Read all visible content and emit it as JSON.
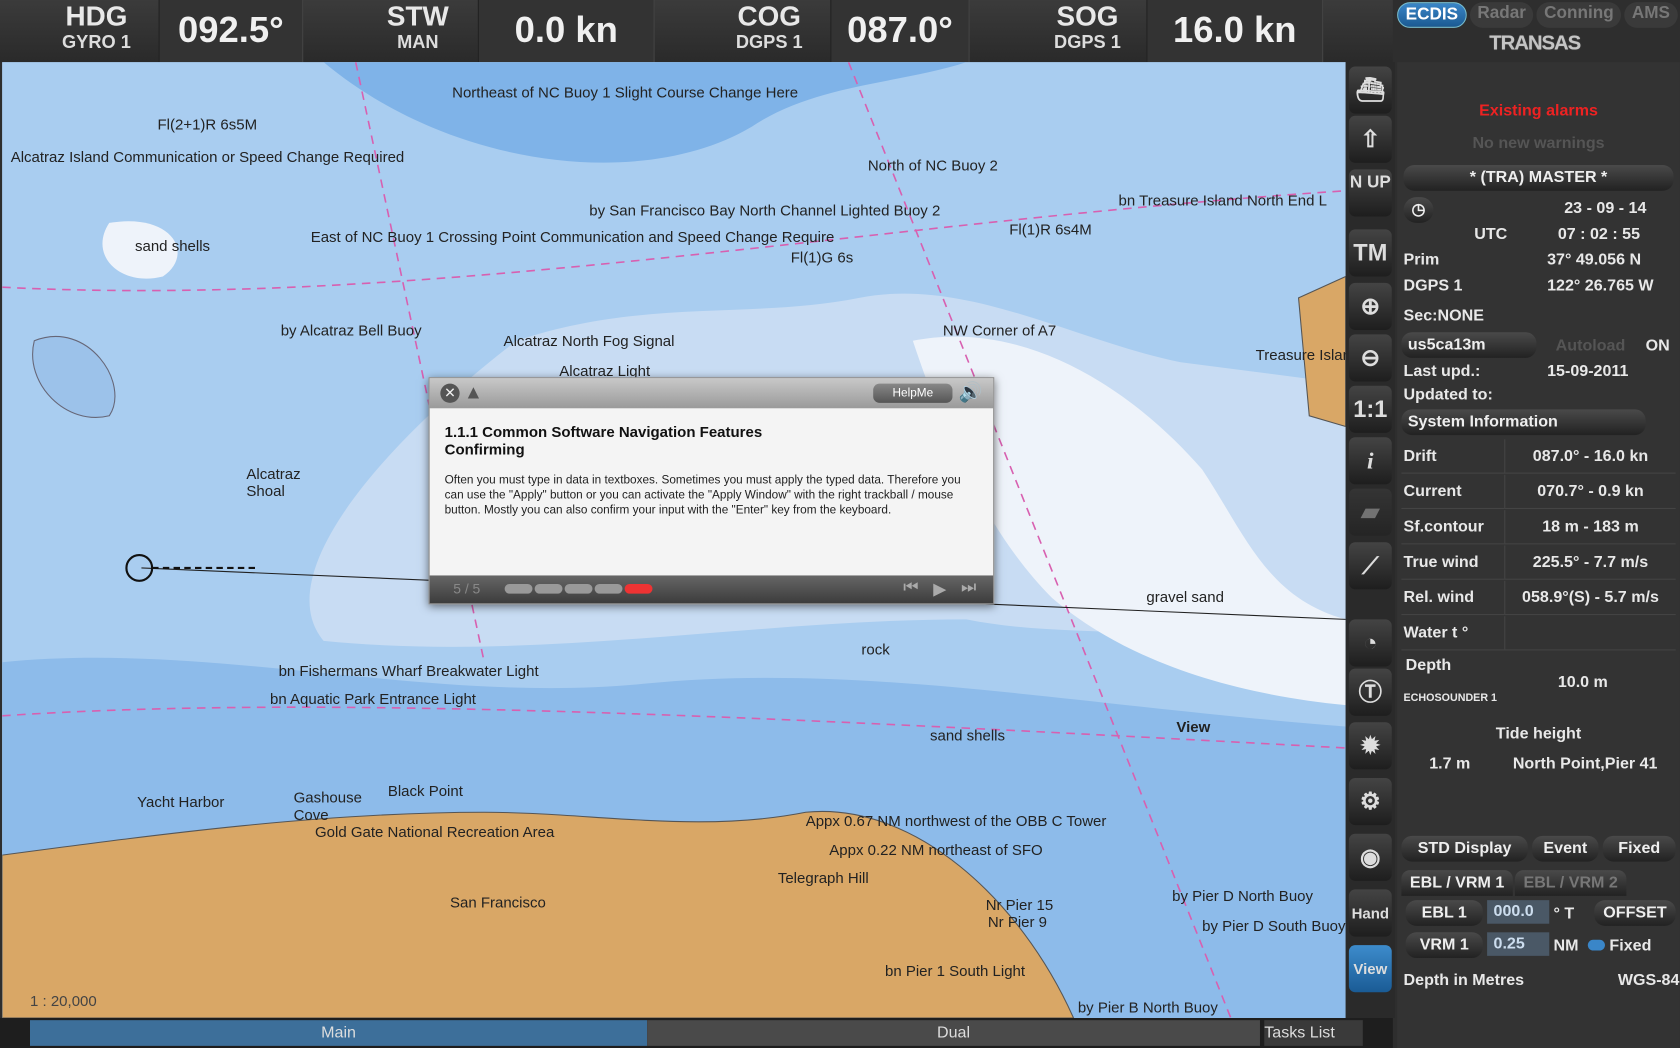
{
  "header": {
    "hdg": {
      "label": "HDG",
      "source": "GYRO 1",
      "value": "092.5°"
    },
    "stw": {
      "label": "STW",
      "source": "MAN",
      "value": "0.0 kn"
    },
    "cog": {
      "label": "COG",
      "source": "DGPS 1",
      "value": "087.0°"
    },
    "sog": {
      "label": "SOG",
      "source": "DGPS 1",
      "value": "16.0 kn"
    }
  },
  "modes": [
    "ECDIS",
    "Radar",
    "Conning",
    "AMS"
  ],
  "brand": "TRANSAS",
  "map": {
    "scale": "1 : 20,000",
    "labels": [
      "Northeast of NC Buoy 1 Slight Course Change Here",
      "Alcatraz Island Communication or Speed Change Required",
      "Fl(2+1)R 6s5M",
      "North of NC Buoy 2",
      "bn Treasure Island North End L",
      "by San Francisco Bay North Channel Lighted Buoy 2",
      "East of NC Buoy 1 Crossing Point Communication and Speed Change Require",
      "Fl(1)G 6s",
      "Fl(1)R 6s4M",
      "sand shells",
      "by Alcatraz Bell Buoy",
      "Alcatraz North Fog Signal",
      "Alcatraz Light",
      "NW Corner of A7",
      "Treasure Island",
      "Alcatraz Shoal",
      "gravel sand",
      "rock",
      "View",
      "bn Fishermans Wharf Breakwater Light",
      "bn Aquatic Park Entrance Light",
      "Yacht Harbor",
      "Black Point",
      "Gashouse Cove",
      "Gold Gate National Recreation Area",
      "Appx 0.67 NM northwest of the OBB C Tower",
      "Appx 0.22 NM northeast of SFO",
      "Telegraph Hill",
      "San Francisco",
      "by Pier D North Buoy",
      "by Pier D South Buoy",
      "bn Pier 1 South Light",
      "by Pier B North Buoy",
      "sand shells",
      "Nr Pier 15",
      "Nr Pier 9"
    ]
  },
  "tools": {
    "nup": "N UP",
    "tm": "TM",
    "one": "1:1",
    "info": "i",
    "hand": "Hand",
    "view": "View"
  },
  "panel": {
    "alarms": "Existing alarms",
    "warnings": "No new warnings",
    "user": "* (TRA) MASTER *",
    "date": "23 - 09 - 14",
    "utc_label": "UTC",
    "time": "07 : 02 : 55",
    "prim_label": "Prim",
    "lat": "37° 49.056 N",
    "dgps_label": "DGPS 1",
    "lon": "122° 26.765 W",
    "sec": "Sec:NONE",
    "chart": "us5ca13m",
    "autoload": "Autoload",
    "autoload_state": "ON",
    "last_upd_label": "Last upd.:",
    "last_upd": "15-09-2011",
    "updated_to_label": "Updated to:",
    "sysinfo": "System Information",
    "rows": [
      {
        "k": "Drift",
        "v": "087.0° - 16.0 kn"
      },
      {
        "k": "Current",
        "v": "070.7° - 0.9 kn"
      },
      {
        "k": "Sf.contour",
        "v": "18 m - 183 m"
      },
      {
        "k": "True wind",
        "v": "225.5° - 7.7 m/s"
      },
      {
        "k": "Rel. wind",
        "v": "058.9°(S) - 5.7 m/s"
      },
      {
        "k": "Water t °",
        "v": ""
      }
    ],
    "depth_label": "Depth",
    "depth_src": "ECHOSOUNDER 1",
    "depth": "10.0 m",
    "tide_label": "Tide height",
    "tide": "1.7 m",
    "tide_loc": "North Point,Pier 41",
    "std": "STD Display",
    "event": "Event",
    "fixed": "Fixed",
    "ebl_tab1": "EBL / VRM 1",
    "ebl_tab2": "EBL / VRM 2",
    "ebl": "EBL 1",
    "ebl_val": "000.0",
    "ebl_unit": "° T",
    "offset": "OFFSET",
    "vrm": "VRM 1",
    "vrm_val": "0.25",
    "vrm_unit": "NM",
    "vrm_fixed": "Fixed",
    "depth_units": "Depth in Metres",
    "datum": "WGS-84"
  },
  "dialog": {
    "helpme": "HelpMe",
    "title1": "1.1.1 Common Software Navigation Features",
    "title2": "Confirming",
    "body": "Often you must type in data in textboxes. Sometimes you must apply the typed data. Therefore you can use the \"Apply\" button or you can activate the \"Apply  Window\" with the right trackball / mouse button. Mostly you can also confirm your input with the \"Enter\" key from the keyboard.",
    "page": "5 / 5",
    "progress": 1.0
  },
  "bottom": {
    "main": "Main",
    "dual": "Dual",
    "tasks": "Tasks List"
  }
}
